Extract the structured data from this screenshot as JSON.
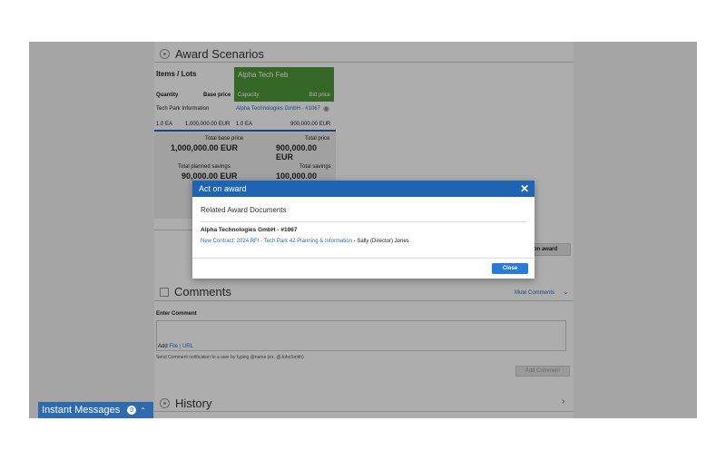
{
  "award_scenarios": {
    "title": "Award Scenarios",
    "items_header": "Items / Lots",
    "col_quantity": "Quantity",
    "col_base_price": "Base price",
    "row_label": "Tech Park Information",
    "row_quantity": "1.0 EA",
    "row_base_price": "1,000,000.00 EUR",
    "total_base_price_label": "Total base price",
    "total_base_price": "1,000,000.00 EUR",
    "total_planned_savings_label": "Total planned savings",
    "total_planned_savings": "90,000.00 EUR",
    "supplier_column": {
      "header": "Alpha Tech Feb",
      "capacity_label": "Capacity",
      "bid_price_label": "Bid price",
      "supplier_link": "Alpha Technologies GmbH - #1067",
      "quantity": "1.0 EA",
      "bid_price": "900,000.00 EUR",
      "total_price_label": "Total price",
      "total_price": "900,000.00 EUR",
      "total_savings_label": "Total savings",
      "total_savings": "100,000.00 EUR"
    },
    "act_on_award_button": "on award"
  },
  "comments": {
    "title": "Comments",
    "mute_link": "Mute Comments",
    "enter_comment_label": "Enter Comment",
    "add_label": "Add",
    "file_link": "File",
    "url_link": "URL",
    "hint": "Send Comment notification to a user by typing @name (ex. @JohnSmith)",
    "add_comment_button": "Add Comment"
  },
  "history": {
    "title": "History"
  },
  "instant_messages": {
    "label": "Instant Messages",
    "count": "0"
  },
  "modal": {
    "title": "Act on award",
    "section_title": "Related Award Documents",
    "supplier": "Alpha Technologies GmbH - #1067",
    "contract_link": "New Contract: 2024 RFI - Tech Park 42 Planning & Information",
    "contact_suffix": " - Sally (Director) Jones",
    "close_button": "Close"
  }
}
